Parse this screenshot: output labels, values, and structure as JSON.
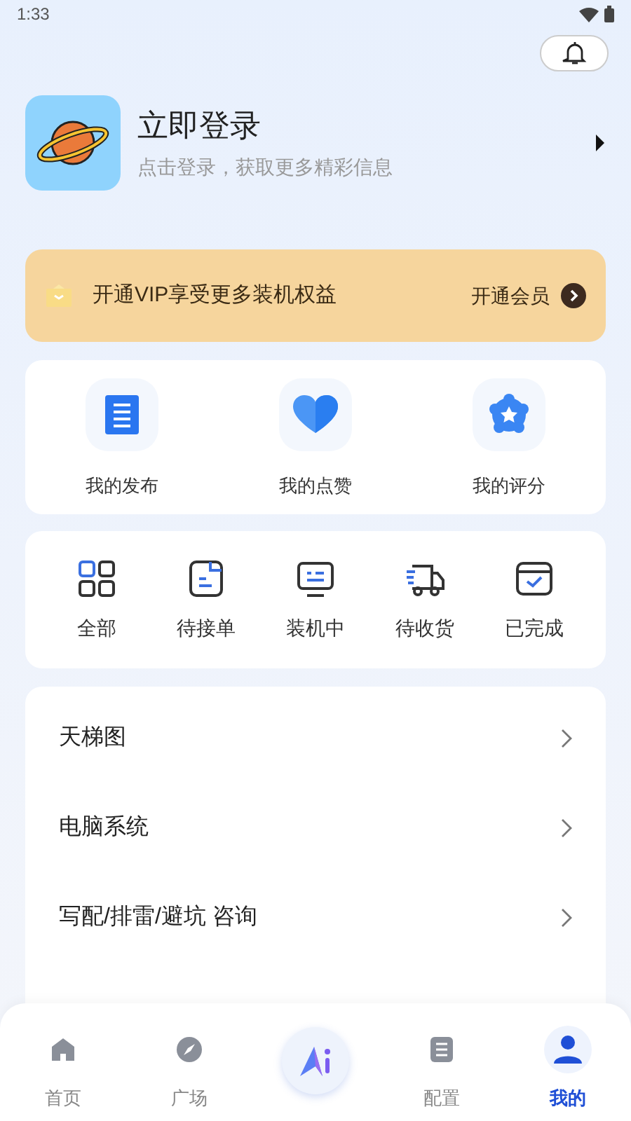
{
  "status_bar": {
    "time": "1:33"
  },
  "profile": {
    "title": "立即登录",
    "subtitle": "点击登录，获取更多精彩信息"
  },
  "vip_banner": {
    "text": "开通VIP享受更多装机权益",
    "action": "开通会员"
  },
  "shortcuts": [
    {
      "label": "我的发布",
      "kind": "doc"
    },
    {
      "label": "我的点赞",
      "kind": "heart"
    },
    {
      "label": "我的评分",
      "kind": "star"
    }
  ],
  "orders": [
    {
      "label": "全部",
      "kind": "grid"
    },
    {
      "label": "待接单",
      "kind": "note"
    },
    {
      "label": "装机中",
      "kind": "monitor"
    },
    {
      "label": "待收货",
      "kind": "truck"
    },
    {
      "label": "已完成",
      "kind": "check"
    }
  ],
  "menu": [
    {
      "label": "天梯图"
    },
    {
      "label": "电脑系统"
    },
    {
      "label": "写配/排雷/避坑 咨询"
    }
  ],
  "nav": [
    {
      "label": "首页",
      "kind": "home",
      "selected": false
    },
    {
      "label": "广场",
      "kind": "compass",
      "selected": false
    },
    {
      "kind": "ai",
      "selected": false
    },
    {
      "label": "配置",
      "kind": "list",
      "selected": false
    },
    {
      "label": "我的",
      "kind": "user",
      "selected": true
    }
  ]
}
